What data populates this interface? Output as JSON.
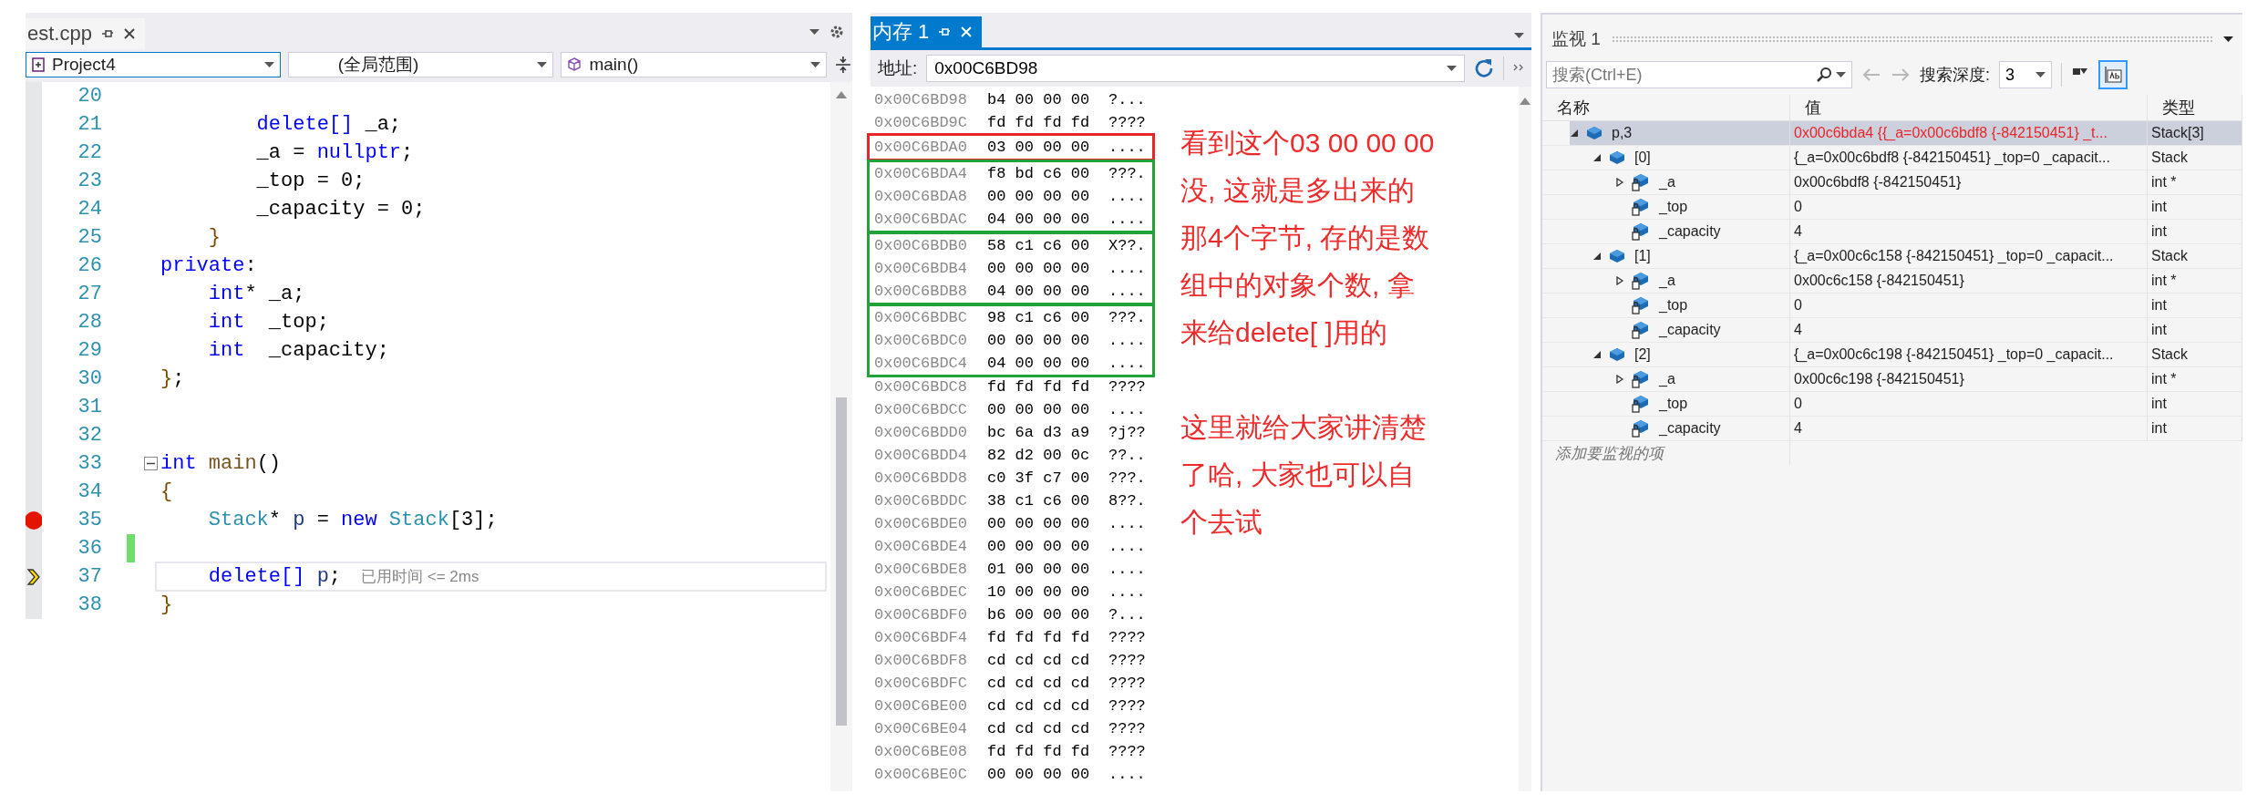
{
  "editor": {
    "tab": {
      "label": "est.cpp",
      "selected": false
    },
    "combos": [
      {
        "kind": "project",
        "value": "Project4",
        "focused": true
      },
      {
        "kind": "scope",
        "value": "(全局范围)",
        "focused": false
      },
      {
        "kind": "function",
        "value": "main()",
        "focused": false
      }
    ],
    "lines": [
      {
        "number": "20",
        "breakpoint": false,
        "current": false,
        "changed": false
      },
      {
        "number": "21",
        "tokens": [
          {
            "kind": "keyword",
            "text": "        delete[]"
          },
          {
            "kind": "plain",
            "text": " _a;"
          }
        ],
        "breakpoint": false,
        "current": false,
        "changed": false
      },
      {
        "number": "22",
        "tokens": [
          {
            "kind": "plain",
            "text": "        _a = "
          },
          {
            "kind": "keyword",
            "text": "nullptr"
          },
          {
            "kind": "plain",
            "text": ";"
          }
        ],
        "breakpoint": false,
        "current": false,
        "changed": false
      },
      {
        "number": "23",
        "tokens": [
          {
            "kind": "plain",
            "text": "        _top = 0;"
          }
        ],
        "breakpoint": false,
        "current": false,
        "changed": false
      },
      {
        "number": "24",
        "tokens": [
          {
            "kind": "plain",
            "text": "        _capacity = 0;"
          }
        ],
        "breakpoint": false,
        "current": false,
        "changed": false
      },
      {
        "number": "25",
        "tokens": [
          {
            "kind": "brace",
            "text": "    }"
          }
        ],
        "breakpoint": false,
        "current": false,
        "changed": false
      },
      {
        "number": "26",
        "tokens": [
          {
            "kind": "keyword",
            "text": "private"
          },
          {
            "kind": "plain",
            "text": ":"
          }
        ],
        "breakpoint": false,
        "current": false,
        "changed": false
      },
      {
        "number": "27",
        "tokens": [
          {
            "kind": "keyword",
            "text": "    int"
          },
          {
            "kind": "plain",
            "text": "* _a;"
          }
        ],
        "breakpoint": false,
        "current": false,
        "changed": false
      },
      {
        "number": "28",
        "tokens": [
          {
            "kind": "keyword",
            "text": "    int"
          },
          {
            "kind": "plain",
            "text": "  _top;"
          }
        ],
        "breakpoint": false,
        "current": false,
        "changed": false
      },
      {
        "number": "29",
        "tokens": [
          {
            "kind": "keyword",
            "text": "    int"
          },
          {
            "kind": "plain",
            "text": "  _capacity;"
          }
        ],
        "breakpoint": false,
        "current": false,
        "changed": false
      },
      {
        "number": "30",
        "tokens": [
          {
            "kind": "brace",
            "text": "}"
          },
          {
            "kind": "plain",
            "text": ";"
          }
        ],
        "breakpoint": false,
        "current": false,
        "changed": false
      },
      {
        "number": "31",
        "breakpoint": false,
        "current": false,
        "changed": false
      },
      {
        "number": "32",
        "breakpoint": false,
        "current": false,
        "changed": false
      },
      {
        "number": "33",
        "tokens": [
          {
            "kind": "keyword",
            "text": "int"
          },
          {
            "kind": "function",
            "text": " main"
          },
          {
            "kind": "plain",
            "text": "()"
          }
        ],
        "fold": true,
        "breakpoint": false,
        "current": false,
        "changed": false
      },
      {
        "number": "34",
        "tokens": [
          {
            "kind": "brace",
            "text": "{"
          }
        ],
        "breakpoint": false,
        "current": false,
        "changed": false
      },
      {
        "number": "35",
        "tokens": [
          {
            "kind": "type",
            "text": "    Stack"
          },
          {
            "kind": "plain",
            "text": "* "
          },
          {
            "kind": "variable",
            "text": "p"
          },
          {
            "kind": "plain",
            "text": " = "
          },
          {
            "kind": "keyword",
            "text": "new"
          },
          {
            "kind": "type",
            "text": " Stack"
          },
          {
            "kind": "plain",
            "text": "[3];"
          }
        ],
        "breakpoint": true,
        "current": false,
        "changed": false
      },
      {
        "number": "36",
        "breakpoint": false,
        "current": false,
        "changed": true
      },
      {
        "number": "37",
        "tokens": [
          {
            "kind": "keyword",
            "text": "    delete[]"
          },
          {
            "kind": "variable",
            "text": " p"
          },
          {
            "kind": "plain",
            "text": ";"
          }
        ],
        "hint": "已用时间 <= 2ms",
        "breakpoint": false,
        "current": true,
        "changed": false
      },
      {
        "number": "38",
        "tokens": [
          {
            "kind": "brace",
            "text": "}"
          }
        ],
        "breakpoint": false,
        "current": false,
        "changed": false
      }
    ]
  },
  "memory": {
    "tab": {
      "label": "内存 1",
      "selected": true
    },
    "address_label": "地址:",
    "address": "0x00C6BD98",
    "rows": [
      {
        "kind": "row",
        "address": "0x00C6BD98",
        "bytes": "b4 00 00 00",
        "chars": "?..."
      },
      {
        "kind": "row",
        "address": "0x00C6BD9C",
        "bytes": "fd fd fd fd",
        "chars": "????"
      },
      {
        "kind": "group",
        "color": "#e8262a",
        "rows": [
          {
            "address": "0x00C6BDA0",
            "bytes": "03 00 00 00",
            "chars": "...."
          }
        ]
      },
      {
        "kind": "group",
        "color": "#22a33a",
        "rows": [
          {
            "address": "0x00C6BDA4",
            "bytes": "f8 bd c6 00",
            "chars": "???."
          },
          {
            "address": "0x00C6BDA8",
            "bytes": "00 00 00 00",
            "chars": "...."
          },
          {
            "address": "0x00C6BDAC",
            "bytes": "04 00 00 00",
            "chars": "...."
          }
        ]
      },
      {
        "kind": "group",
        "color": "#22a33a",
        "rows": [
          {
            "address": "0x00C6BDB0",
            "bytes": "58 c1 c6 00",
            "chars": "X??."
          },
          {
            "address": "0x00C6BDB4",
            "bytes": "00 00 00 00",
            "chars": "...."
          },
          {
            "address": "0x00C6BDB8",
            "bytes": "04 00 00 00",
            "chars": "...."
          }
        ]
      },
      {
        "kind": "group",
        "color": "#22a33a",
        "rows": [
          {
            "address": "0x00C6BDBC",
            "bytes": "98 c1 c6 00",
            "chars": "???."
          },
          {
            "address": "0x00C6BDC0",
            "bytes": "00 00 00 00",
            "chars": "...."
          },
          {
            "address": "0x00C6BDC4",
            "bytes": "04 00 00 00",
            "chars": "...."
          }
        ]
      },
      {
        "kind": "row",
        "address": "0x00C6BDC8",
        "bytes": "fd fd fd fd",
        "chars": "????"
      },
      {
        "kind": "row",
        "address": "0x00C6BDCC",
        "bytes": "00 00 00 00",
        "chars": "...."
      },
      {
        "kind": "row",
        "address": "0x00C6BDD0",
        "bytes": "bc 6a d3 a9",
        "chars": "?j??"
      },
      {
        "kind": "row",
        "address": "0x00C6BDD4",
        "bytes": "82 d2 00 0c",
        "chars": "??.."
      },
      {
        "kind": "row",
        "address": "0x00C6BDD8",
        "bytes": "c0 3f c7 00",
        "chars": "???."
      },
      {
        "kind": "row",
        "address": "0x00C6BDDC",
        "bytes": "38 c1 c6 00",
        "chars": "8??."
      },
      {
        "kind": "row",
        "address": "0x00C6BDE0",
        "bytes": "00 00 00 00",
        "chars": "...."
      },
      {
        "kind": "row",
        "address": "0x00C6BDE4",
        "bytes": "00 00 00 00",
        "chars": "...."
      },
      {
        "kind": "row",
        "address": "0x00C6BDE8",
        "bytes": "01 00 00 00",
        "chars": "...."
      },
      {
        "kind": "row",
        "address": "0x00C6BDEC",
        "bytes": "10 00 00 00",
        "chars": "...."
      },
      {
        "kind": "row",
        "address": "0x00C6BDF0",
        "bytes": "b6 00 00 00",
        "chars": "?..."
      },
      {
        "kind": "row",
        "address": "0x00C6BDF4",
        "bytes": "fd fd fd fd",
        "chars": "????"
      },
      {
        "kind": "row",
        "address": "0x00C6BDF8",
        "bytes": "cd cd cd cd",
        "chars": "????"
      },
      {
        "kind": "row",
        "address": "0x00C6BDFC",
        "bytes": "cd cd cd cd",
        "chars": "????"
      },
      {
        "kind": "row",
        "address": "0x00C6BE00",
        "bytes": "cd cd cd cd",
        "chars": "????"
      },
      {
        "kind": "row",
        "address": "0x00C6BE04",
        "bytes": "cd cd cd cd",
        "chars": "????"
      },
      {
        "kind": "row",
        "address": "0x00C6BE08",
        "bytes": "fd fd fd fd",
        "chars": "????"
      },
      {
        "kind": "row",
        "address": "0x00C6BE0C",
        "bytes": "00 00 00 00",
        "chars": "...."
      }
    ],
    "notes": [
      {
        "lines": [
          "看到这个03 00 00 00",
          "没, 这就是多出来的",
          "那4个字节, 存的是数",
          "组中的对象个数, 拿",
          "来给delete[ ]用的"
        ]
      },
      {
        "lines": [
          "这里就给大家讲清楚",
          "了哈, 大家也可以自",
          "个去试"
        ]
      }
    ]
  },
  "watch": {
    "title": "监视 1",
    "search_placeholder": "搜索(Ctrl+E)",
    "nav_disabled": true,
    "depth_label": "搜索深度:",
    "depth": "3",
    "format_on": true,
    "columns": [
      "名称",
      "值",
      "类型"
    ],
    "items": [
      {
        "kind": "object",
        "name": "p,3",
        "value": "0x00c6bda4 {{_a=0x00c6bdf8 {-842150451} _t...",
        "type": "Stack[3]",
        "expanded": true,
        "selected": true,
        "changed": true,
        "children": [
          {
            "kind": "object",
            "name": "[0]",
            "value": "{_a=0x00c6bdf8 {-842150451} _top=0 _capacit...",
            "type": "Stack",
            "expanded": true,
            "selected": false,
            "changed": false,
            "children": [
              {
                "kind": "member",
                "name": "_a",
                "value": "0x00c6bdf8 {-842150451}",
                "type": "int *",
                "expanded": false,
                "selected": false,
                "changed": false
              },
              {
                "kind": "member",
                "name": "_top",
                "value": "0",
                "type": "int",
                "selected": false,
                "changed": false
              },
              {
                "kind": "member",
                "name": "_capacity",
                "value": "4",
                "type": "int",
                "selected": false,
                "changed": false
              }
            ]
          },
          {
            "kind": "object",
            "name": "[1]",
            "value": "{_a=0x00c6c158 {-842150451} _top=0 _capacit...",
            "type": "Stack",
            "expanded": true,
            "selected": false,
            "changed": false,
            "children": [
              {
                "kind": "member",
                "name": "_a",
                "value": "0x00c6c158 {-842150451}",
                "type": "int *",
                "expanded": false,
                "selected": false,
                "changed": false
              },
              {
                "kind": "member",
                "name": "_top",
                "value": "0",
                "type": "int",
                "selected": false,
                "changed": false
              },
              {
                "kind": "member",
                "name": "_capacity",
                "value": "4",
                "type": "int",
                "selected": false,
                "changed": false
              }
            ]
          },
          {
            "kind": "object",
            "name": "[2]",
            "value": "{_a=0x00c6c198 {-842150451} _top=0 _capacit...",
            "type": "Stack",
            "expanded": true,
            "selected": false,
            "changed": false,
            "children": [
              {
                "kind": "member",
                "name": "_a",
                "value": "0x00c6c198 {-842150451}",
                "type": "int *",
                "expanded": false,
                "selected": false,
                "changed": false
              },
              {
                "kind": "member",
                "name": "_top",
                "value": "0",
                "type": "int",
                "selected": false,
                "changed": false
              },
              {
                "kind": "member",
                "name": "_capacity",
                "value": "4",
                "type": "int",
                "selected": false,
                "changed": false
              }
            ]
          }
        ]
      }
    ],
    "add_placeholder": "添加要监视的项"
  }
}
